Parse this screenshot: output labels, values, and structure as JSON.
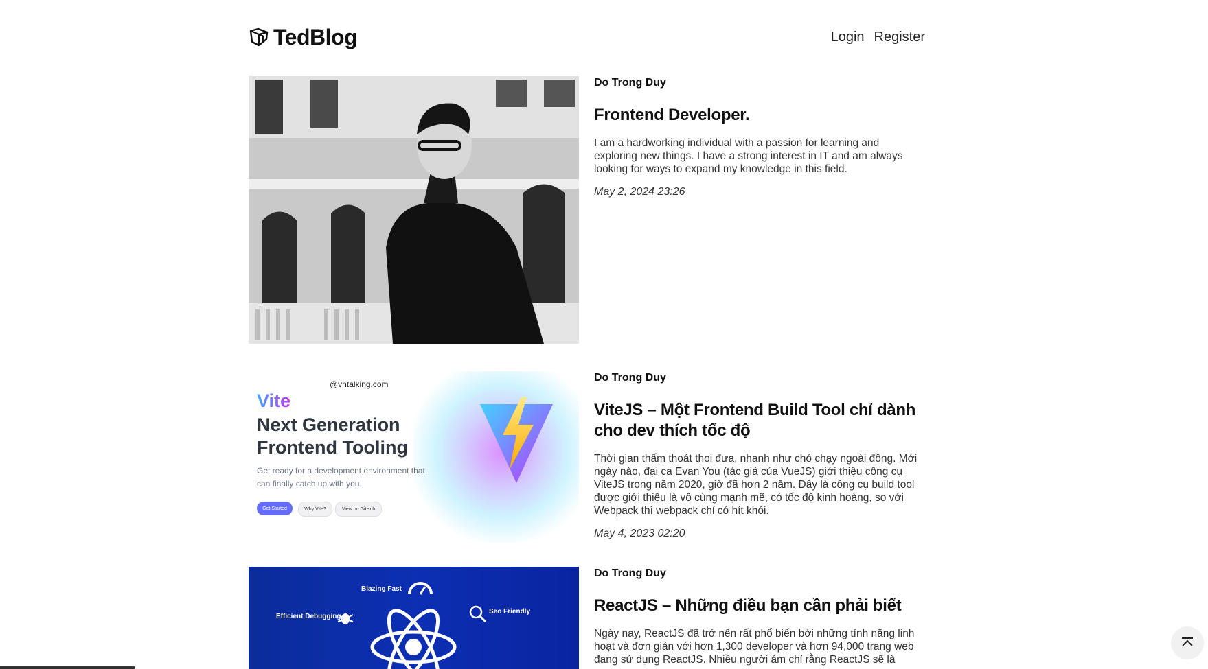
{
  "header": {
    "brand": "TedBlog",
    "nav": {
      "login": "Login",
      "register": "Register"
    }
  },
  "posts": [
    {
      "author": "Do Trong Duy",
      "title": "Frontend Developer.",
      "excerpt": "I am a hardworking individual with a passion for learning and exploring new things. I have a strong interest in IT and am always looking for ways to expand my knowledge in this field.",
      "date": "May 2, 2024 23:26"
    },
    {
      "author": "Do Trong Duy",
      "title": "ViteJS – Một Frontend Build Tool chỉ dành cho dev thích tốc độ",
      "excerpt": "Thời gian thấm thoát thoi đưa, nhanh như chó chạy ngoài đồng. Mới ngày nào, đại ca Evan You (tác giả của VueJS) giới thiệu công cụ ViteJS trong năm 2020, giờ đã hơn 2 năm. Đây là công cụ build tool được giới thiệu là vô cùng mạnh mẽ, có tốc độ kinh hoàng, so với Webpack thì webpack chỉ có hít khói.",
      "date": "May 4, 2023 02:20",
      "thumb": {
        "handle": "@vntalking.com",
        "name": "Vite",
        "headline_line1": "Next Generation",
        "headline_line2": "Frontend Tooling",
        "subtitle": "Get ready for a development environment that can finally catch up with you.",
        "btn_primary": "Get Started",
        "btn_why": "Why Vite?",
        "btn_github": "View on GitHub"
      }
    },
    {
      "author": "Do Trong Duy",
      "title": "ReactJS – Những điều bạn cần phải biết",
      "excerpt": "Ngày nay, ReactJS đã trở nên rất phổ biến bởi những tính năng linh hoạt và đơn giản với hơn 1,300 developer và hơn 94,000 trang web đang sử dụng ReactJS. Nhiều người ám chỉ rằng ReactJS sẽ là",
      "thumb": {
        "label_fast": "Blazing Fast",
        "label_debug": "Efficient Debugging",
        "label_seo": "Seo Friendly"
      }
    }
  ],
  "colors": {
    "vite_purple": "#bd34fe",
    "vite_blue": "#41a6ff",
    "react_bg": "#0c2fb3"
  }
}
